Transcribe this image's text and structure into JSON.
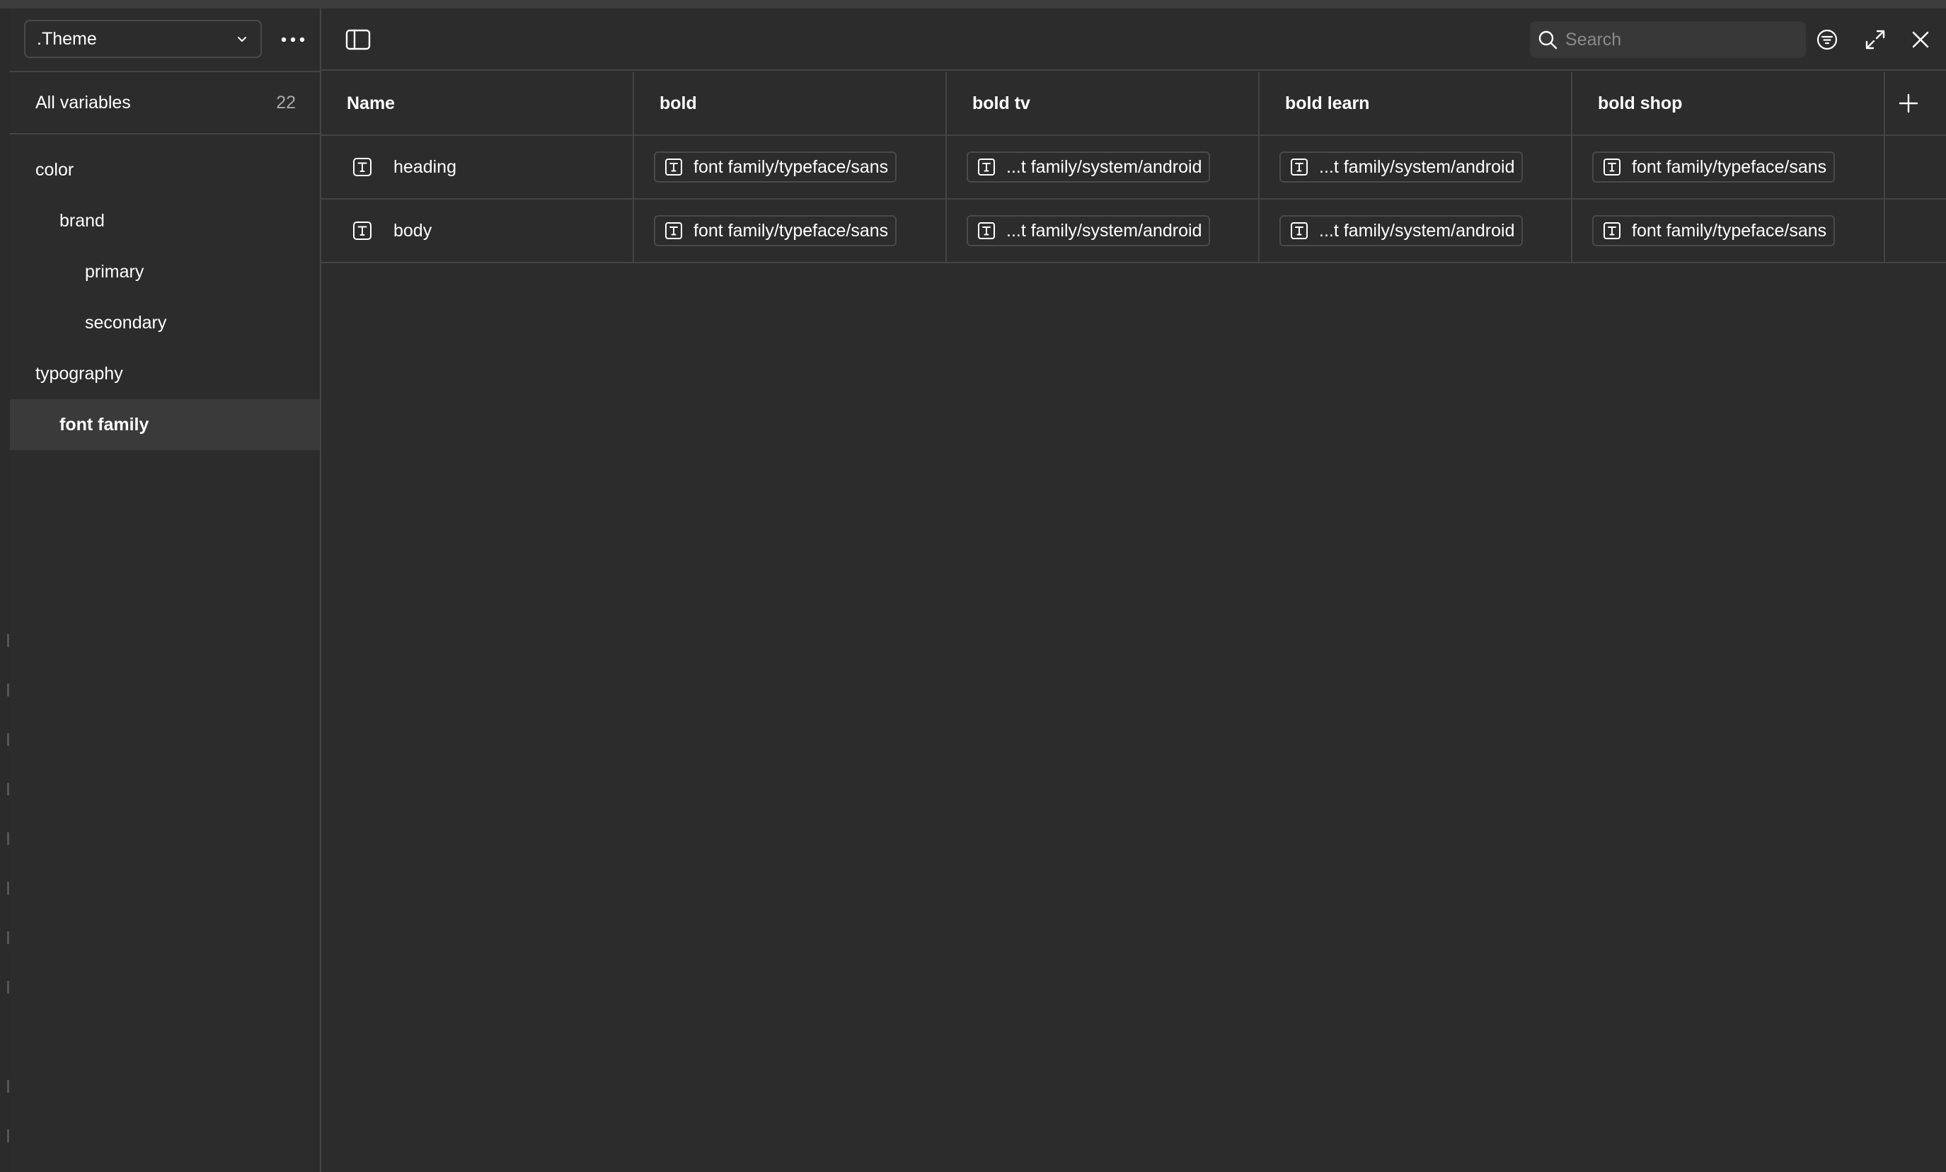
{
  "sidebar": {
    "collection_select": ".Theme",
    "all_variables": {
      "label": "All variables",
      "count": "22"
    },
    "groups": [
      {
        "label": "color",
        "level": 0
      },
      {
        "label": "brand",
        "level": 1
      },
      {
        "label": "primary",
        "level": 2
      },
      {
        "label": "secondary",
        "level": 2
      },
      {
        "label": "typography",
        "level": 0
      },
      {
        "label": "font family",
        "level": 1,
        "active": true
      }
    ]
  },
  "toolbar": {
    "search_placeholder": "Search"
  },
  "table": {
    "columns": [
      "Name",
      "bold",
      "bold tv",
      "bold learn",
      "bold shop"
    ],
    "rows": [
      {
        "name": "heading",
        "values": [
          "font family/typeface/sans",
          "...t family/system/android",
          "...t family/system/android",
          "font family/typeface/sans"
        ]
      },
      {
        "name": "body",
        "values": [
          "font family/typeface/sans",
          "...t family/system/android",
          "...t family/system/android",
          "font family/typeface/sans"
        ]
      }
    ]
  },
  "icons": {
    "type_icon": "text-type-icon",
    "add_column": "plus-icon",
    "filter": "filter-icon",
    "expand": "expand-icon",
    "close": "close-icon",
    "toggle_sidebar": "sidebar-toggle-icon"
  },
  "colors": {
    "background": "#2c2c2c",
    "border": "#444444",
    "active_row": "#3a3a3a",
    "muted_text": "#a8a8a8"
  }
}
